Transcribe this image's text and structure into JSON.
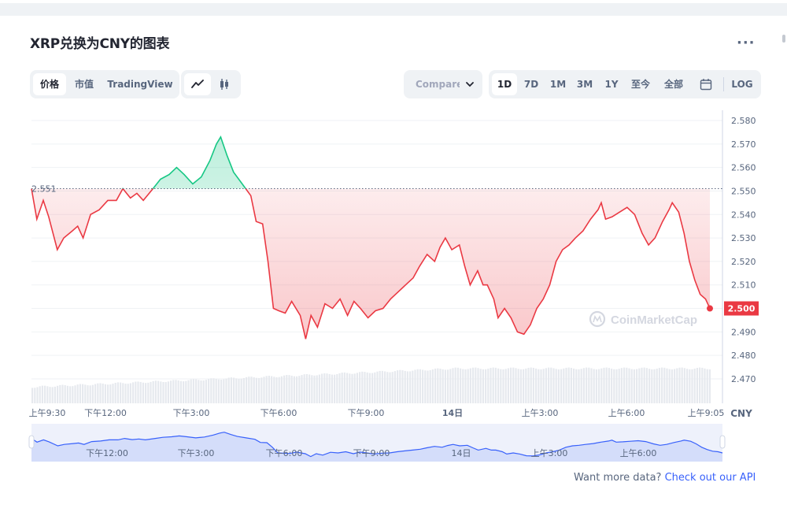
{
  "header": {
    "title": "XRP兑换为CNY的图表"
  },
  "tabs": [
    {
      "label": "价格",
      "active": true
    },
    {
      "label": "市值",
      "active": false
    },
    {
      "label": "TradingView",
      "active": false
    }
  ],
  "chart_types": [
    {
      "icon": "line-chart-icon",
      "active": true
    },
    {
      "icon": "candlestick-icon",
      "active": false
    }
  ],
  "compare": {
    "label": "Compare with"
  },
  "ranges": [
    {
      "label": "1D",
      "active": true
    },
    {
      "label": "7D",
      "active": false
    },
    {
      "label": "1M",
      "active": false
    },
    {
      "label": "3M",
      "active": false
    },
    {
      "label": "1Y",
      "active": false
    },
    {
      "label": "至今",
      "active": false
    },
    {
      "label": "全部",
      "active": false
    }
  ],
  "log_label": "LOG",
  "calendar_icon": "calendar-icon",
  "colors": {
    "up": "#16c784",
    "down": "#ea3943",
    "accent": "#3861fb",
    "navigator": "#3861fb"
  },
  "footer": {
    "text": "Want more data?",
    "link": "Check out our API"
  },
  "chart_data": {
    "type": "line",
    "currency": "CNY",
    "open_price": "2.551",
    "current_price": "2.500",
    "watermark": "CoinMarketCap",
    "ylim": [
      2.462,
      2.588
    ],
    "y_ticks": [
      "2.580",
      "2.570",
      "2.560",
      "2.550",
      "2.540",
      "2.530",
      "2.520",
      "2.510",
      "2.500",
      "2.490",
      "2.480",
      "2.470"
    ],
    "x_ticks": [
      {
        "label": "上午9:30",
        "bold": false
      },
      {
        "label": "下午12:00",
        "bold": false
      },
      {
        "label": "下午3:00",
        "bold": false
      },
      {
        "label": "下午6:00",
        "bold": false
      },
      {
        "label": "下午9:00",
        "bold": false
      },
      {
        "label": "14日",
        "bold": true
      },
      {
        "label": "上午3:00",
        "bold": false
      },
      {
        "label": "上午6:00",
        "bold": false
      },
      {
        "label": "上午9:05",
        "bold": false
      }
    ],
    "navigator_ticks": [
      "下午12:00",
      "下午3:00",
      "下午6:00",
      "下午9:00",
      "14日",
      "上午3:00",
      "上午6:00"
    ],
    "price_points": [
      [
        0,
        2.551
      ],
      [
        0.5,
        2.538
      ],
      [
        1.1,
        2.546
      ],
      [
        1.6,
        2.539
      ],
      [
        2.4,
        2.525
      ],
      [
        3.0,
        2.53
      ],
      [
        3.8,
        2.533
      ],
      [
        4.3,
        2.535
      ],
      [
        4.8,
        2.53
      ],
      [
        5.5,
        2.54
      ],
      [
        6.3,
        2.542
      ],
      [
        7.1,
        2.546
      ],
      [
        7.9,
        2.546
      ],
      [
        8.5,
        2.551
      ],
      [
        9.2,
        2.547
      ],
      [
        9.8,
        2.549
      ],
      [
        10.4,
        2.546
      ],
      [
        11.3,
        2.551
      ],
      [
        12.0,
        2.555
      ],
      [
        12.8,
        2.557
      ],
      [
        13.5,
        2.56
      ],
      [
        14.2,
        2.557
      ],
      [
        15.0,
        2.553
      ],
      [
        15.8,
        2.556
      ],
      [
        16.6,
        2.563
      ],
      [
        17.2,
        2.57
      ],
      [
        17.6,
        2.573
      ],
      [
        18.2,
        2.565
      ],
      [
        18.8,
        2.558
      ],
      [
        19.6,
        2.553
      ],
      [
        20.4,
        2.548
      ],
      [
        20.9,
        2.537
      ],
      [
        21.5,
        2.536
      ],
      [
        22.0,
        2.52
      ],
      [
        22.5,
        2.5
      ],
      [
        23.0,
        2.499
      ],
      [
        23.6,
        2.498
      ],
      [
        24.2,
        2.503
      ],
      [
        25.0,
        2.497
      ],
      [
        25.5,
        2.487
      ],
      [
        26.0,
        2.497
      ],
      [
        26.6,
        2.492
      ],
      [
        27.3,
        2.502
      ],
      [
        28.0,
        2.5
      ],
      [
        28.7,
        2.504
      ],
      [
        29.4,
        2.497
      ],
      [
        30.0,
        2.503
      ],
      [
        30.6,
        2.5
      ],
      [
        31.3,
        2.496
      ],
      [
        32.0,
        2.499
      ],
      [
        32.7,
        2.5
      ],
      [
        33.4,
        2.504
      ],
      [
        34.1,
        2.507
      ],
      [
        34.8,
        2.51
      ],
      [
        35.5,
        2.513
      ],
      [
        36.1,
        2.518
      ],
      [
        36.8,
        2.523
      ],
      [
        37.5,
        2.52
      ],
      [
        38.0,
        2.526
      ],
      [
        38.5,
        2.53
      ],
      [
        39.1,
        2.525
      ],
      [
        39.8,
        2.527
      ],
      [
        40.3,
        2.518
      ],
      [
        40.8,
        2.51
      ],
      [
        41.5,
        2.516
      ],
      [
        42.0,
        2.51
      ],
      [
        42.4,
        2.51
      ],
      [
        43.0,
        2.504
      ],
      [
        43.4,
        2.496
      ],
      [
        44.0,
        2.5
      ],
      [
        44.6,
        2.496
      ],
      [
        45.2,
        2.49
      ],
      [
        45.8,
        2.489
      ],
      [
        46.4,
        2.493
      ],
      [
        47.0,
        2.5
      ],
      [
        47.6,
        2.504
      ],
      [
        48.2,
        2.51
      ],
      [
        48.8,
        2.52
      ],
      [
        49.4,
        2.525
      ],
      [
        50.0,
        2.527
      ],
      [
        50.6,
        2.53
      ],
      [
        51.3,
        2.533
      ],
      [
        52.0,
        2.538
      ],
      [
        52.7,
        2.542
      ],
      [
        53.0,
        2.545
      ],
      [
        53.4,
        2.538
      ],
      [
        54.0,
        2.539
      ],
      [
        54.7,
        2.541
      ],
      [
        55.4,
        2.543
      ],
      [
        56.1,
        2.54
      ],
      [
        56.8,
        2.532
      ],
      [
        57.4,
        2.527
      ],
      [
        58.0,
        2.53
      ],
      [
        58.7,
        2.537
      ],
      [
        59.3,
        2.542
      ],
      [
        59.6,
        2.545
      ],
      [
        60.2,
        2.541
      ],
      [
        60.7,
        2.532
      ],
      [
        61.2,
        2.52
      ],
      [
        61.7,
        2.512
      ],
      [
        62.2,
        2.506
      ],
      [
        62.7,
        2.504
      ],
      [
        63.1,
        2.5
      ]
    ],
    "volume": {
      "start": 0.35,
      "end": 0.75
    },
    "navigator_range": [
      "上午9:30",
      "上午9:05"
    ]
  }
}
